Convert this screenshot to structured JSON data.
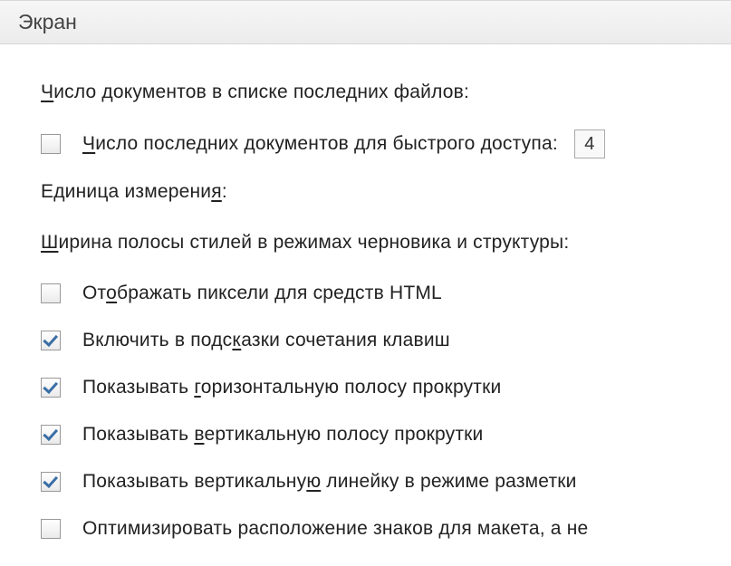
{
  "section": {
    "title": "Экран"
  },
  "rows": {
    "recent_docs_label": {
      "pre": "",
      "u": "Ч",
      "post": "исло документов в списке последних файлов:"
    },
    "quick_access": {
      "checked": false,
      "pre": "",
      "u": "Ч",
      "post": "исло последних документов для быстрого доступа:",
      "value": "4"
    },
    "unit_label": {
      "pre": "Единица измерени",
      "u": "я",
      "post": ":"
    },
    "style_width_label": {
      "pre": "",
      "u": "Ш",
      "post": "ирина полосы стилей в режимах черновика и структуры:"
    },
    "html_pixels": {
      "checked": false,
      "pre": "От",
      "u": "о",
      "post": "бражать пиксели для средств HTML"
    },
    "tooltips_shortcuts": {
      "checked": true,
      "pre": "Включить в подс",
      "u": "к",
      "post": "азки сочетания клавиш"
    },
    "h_scroll": {
      "checked": true,
      "pre": "Показывать ",
      "u": "г",
      "post": "оризонтальную полосу прокрутки"
    },
    "v_scroll": {
      "checked": true,
      "pre": "Показывать ",
      "u": "в",
      "post": "ертикальную полосу прокрутки"
    },
    "v_ruler": {
      "checked": true,
      "pre": "Показывать вертикальну",
      "u": "ю",
      "post": " линейку в режиме разметки"
    },
    "optimize_layout": {
      "checked": false,
      "pre": "Оптимизировать расположение знаков для макета, а не ",
      "u": "",
      "post": ""
    }
  }
}
